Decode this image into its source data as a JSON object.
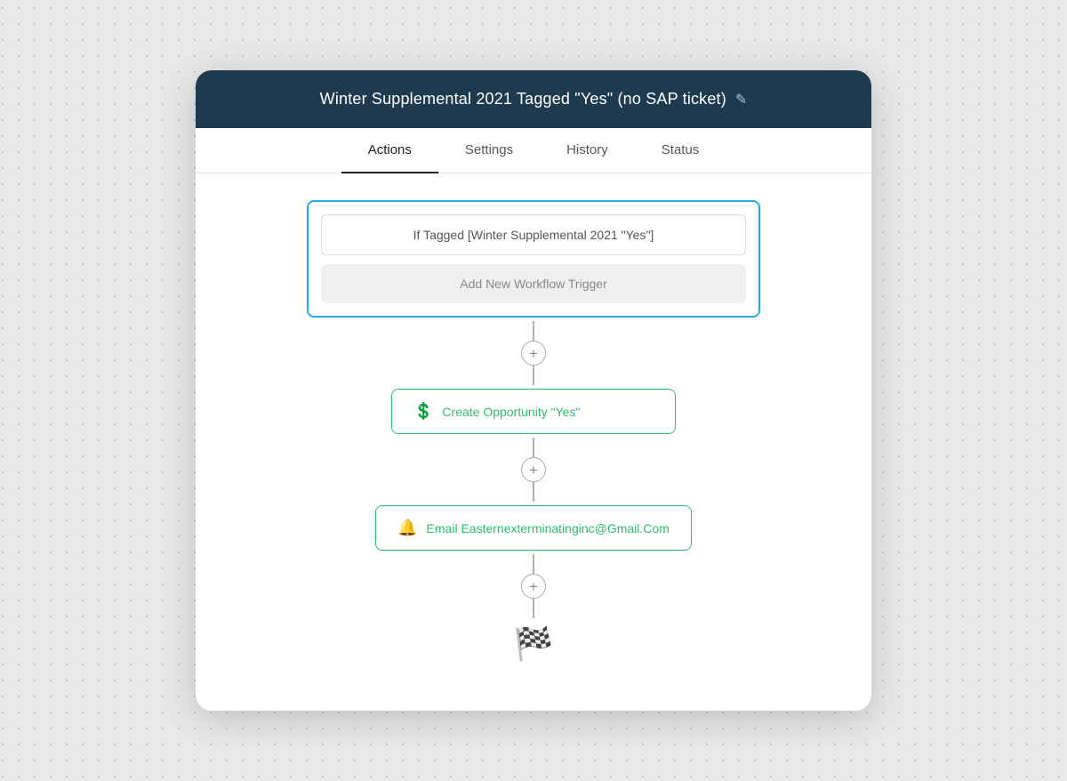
{
  "header": {
    "title": "Winter Supplemental 2021 Tagged \"Yes\" (no SAP ticket)",
    "edit_icon": "✎"
  },
  "tabs": [
    {
      "label": "Actions",
      "active": true
    },
    {
      "label": "Settings",
      "active": false
    },
    {
      "label": "History",
      "active": false
    },
    {
      "label": "Status",
      "active": false
    }
  ],
  "trigger": {
    "condition_label": "If Tagged [Winter Supplemental 2021 \"Yes\"]",
    "add_trigger_label": "Add New Workflow Trigger"
  },
  "actions": [
    {
      "icon": "💲",
      "label": "Create Opportunity \"Yes\""
    },
    {
      "icon": "🔔",
      "label": "Email Easternexterminatinginc@Gmail.Com"
    }
  ],
  "add_button_symbol": "+",
  "finish_flag": "🏁"
}
